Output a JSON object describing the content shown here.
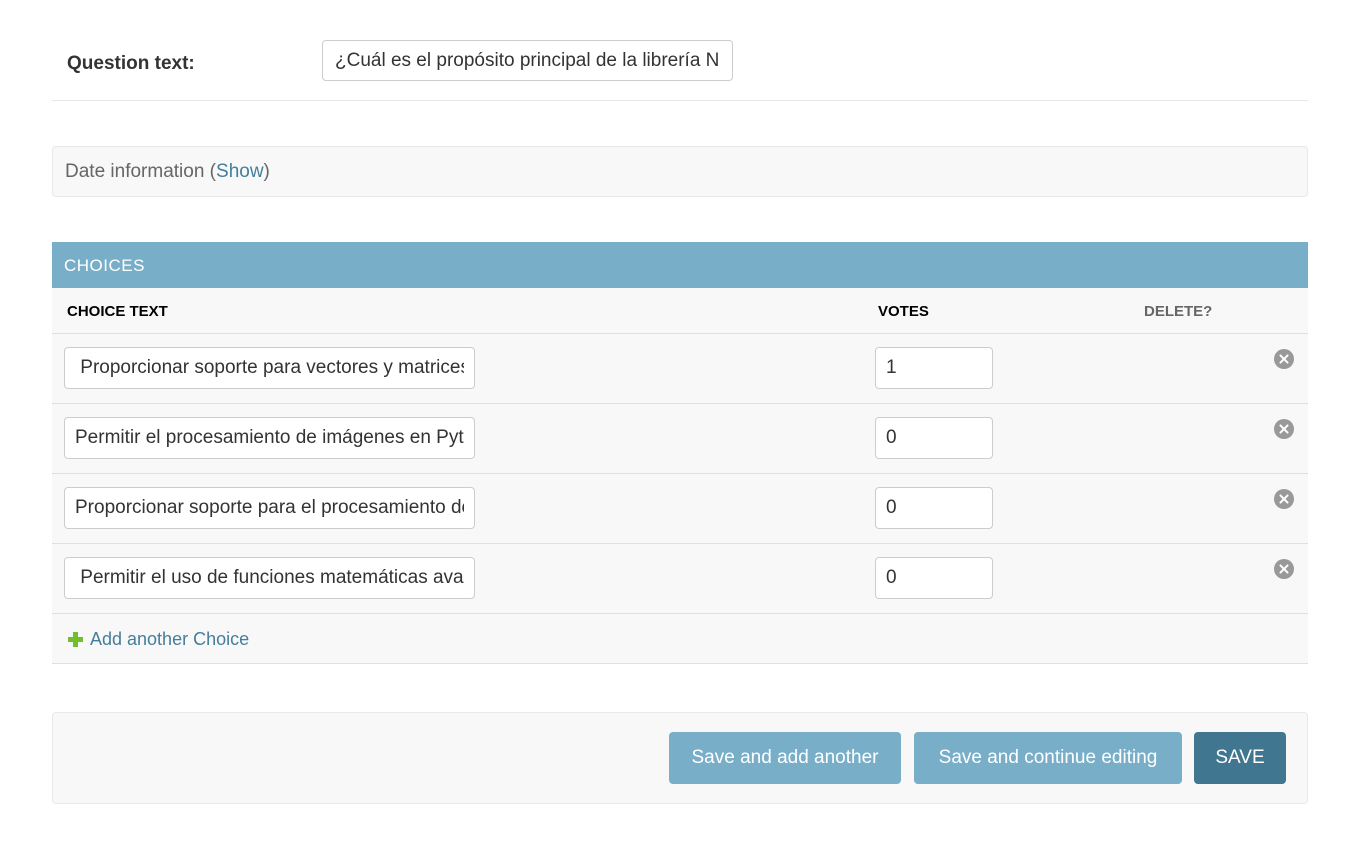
{
  "question": {
    "label": "Question text:",
    "value": "¿Cuál es el propósito principal de la librería NumPy?"
  },
  "date_info": {
    "label": "Date information (",
    "toggle": "Show",
    "close": ")"
  },
  "choices": {
    "title": "CHOICES",
    "columns": {
      "choice_text": "CHOICE TEXT",
      "votes": "VOTES",
      "delete": "DELETE?"
    },
    "rows": [
      {
        "text": " Proporcionar soporte para vectores y matrices",
        "votes": "1"
      },
      {
        "text": "Permitir el procesamiento de imágenes en Python",
        "votes": "0"
      },
      {
        "text": "Proporcionar soporte para el procesamiento de datos",
        "votes": "0"
      },
      {
        "text": " Permitir el uso de funciones matemáticas avanzadas",
        "votes": "0"
      }
    ],
    "add_label": "Add another Choice"
  },
  "submit": {
    "save_add": "Save and add another",
    "save_continue": "Save and continue editing",
    "save": "SAVE"
  },
  "colors": {
    "header_bg": "#79aec8",
    "primary_button": "#417690",
    "link": "#447e9b",
    "add_icon": "#70bf2b"
  },
  "icons": {
    "delete": "close-circle-icon",
    "add": "plus-icon"
  }
}
